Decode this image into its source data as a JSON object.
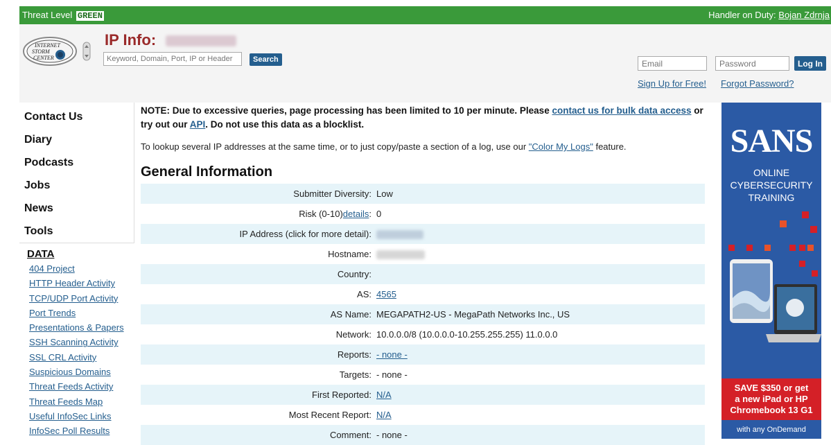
{
  "topbar": {
    "threat_label": "Threat Level",
    "threat_value": "GREEN",
    "handler_prefix": "Handler on Duty:",
    "handler_name": "Bojan Zdrnja"
  },
  "header": {
    "title": "IP Info:",
    "search_placeholder": "Keyword, Domain, Port, IP or Header",
    "search_button": "Search",
    "email_placeholder": "Email",
    "password_placeholder": "Password",
    "login_button": "Log In",
    "signup_link": "Sign Up for Free!",
    "forgot_link": "Forgot Password?"
  },
  "nav": {
    "items": [
      "Contact Us",
      "Diary",
      "Podcasts",
      "Jobs",
      "News",
      "Tools"
    ],
    "data_header": "DATA",
    "data_links": [
      "404 Project",
      "HTTP Header Activity",
      "TCP/UDP Port Activity",
      "Port Trends",
      "Presentations & Papers",
      "SSH Scanning Activity",
      "SSL CRL Activity",
      "Suspicious Domains",
      "Threat Feeds Activity",
      "Threat Feeds Map",
      "Useful InfoSec Links",
      "InfoSec Poll Results"
    ]
  },
  "main": {
    "note_1": "NOTE: Due to excessive queries, page processing has been limited to 10 per minute. Please ",
    "note_link_1": "contact us for bulk data access",
    "note_2": " or try out our ",
    "note_link_2": "API",
    "note_3": ". Do not use this data as a blocklist.",
    "lookup_1": "To lookup several IP addresses at the same time, or to just copy/paste a section of a log, use our ",
    "lookup_link": "\"Color My Logs\"",
    "lookup_2": " feature.",
    "section_title": "General Information",
    "rows": {
      "diversity": {
        "label": "Submitter Diversity:",
        "value": "Low"
      },
      "risk": {
        "label": "Risk (0-10)",
        "link": "details",
        "colon": ":",
        "value": "0"
      },
      "ip": {
        "label": "IP Address (click for more detail):"
      },
      "hostname": {
        "label": "Hostname:"
      },
      "country": {
        "label": "Country:",
        "value": ""
      },
      "as": {
        "label": "AS:",
        "value": "4565"
      },
      "asname": {
        "label": "AS Name:",
        "value": "MEGAPATH2-US - MegaPath Networks Inc., US"
      },
      "network": {
        "label": "Network:",
        "value": "10.0.0.0/8 (10.0.0.0-10.255.255.255) 11.0.0.0"
      },
      "reports": {
        "label": "Reports:",
        "value": "- none -"
      },
      "targets": {
        "label": "Targets:",
        "value": "- none -"
      },
      "first": {
        "label": "First Reported:",
        "value": "N/A"
      },
      "recent": {
        "label": "Most Recent Report:",
        "value": "N/A"
      },
      "comment": {
        "label": "Comment:",
        "value": "- none -"
      }
    }
  },
  "ad": {
    "brand": "SANS",
    "line1": "ONLINE",
    "line2": "CYBERSECURITY",
    "line3": "TRAINING",
    "promo_1": "SAVE $350 or get",
    "promo_2": "a new iPad or HP",
    "promo_3": "Chromebook 13 G1",
    "footer": "with any OnDemand",
    "colors": {
      "blue": "#2b5aa5",
      "red": "#d42027"
    }
  },
  "colors": {
    "threat_bar": "#3a9a3a",
    "title": "#9a2a2a",
    "link": "#245e8e",
    "row_stripe": "#e6f4f9"
  }
}
